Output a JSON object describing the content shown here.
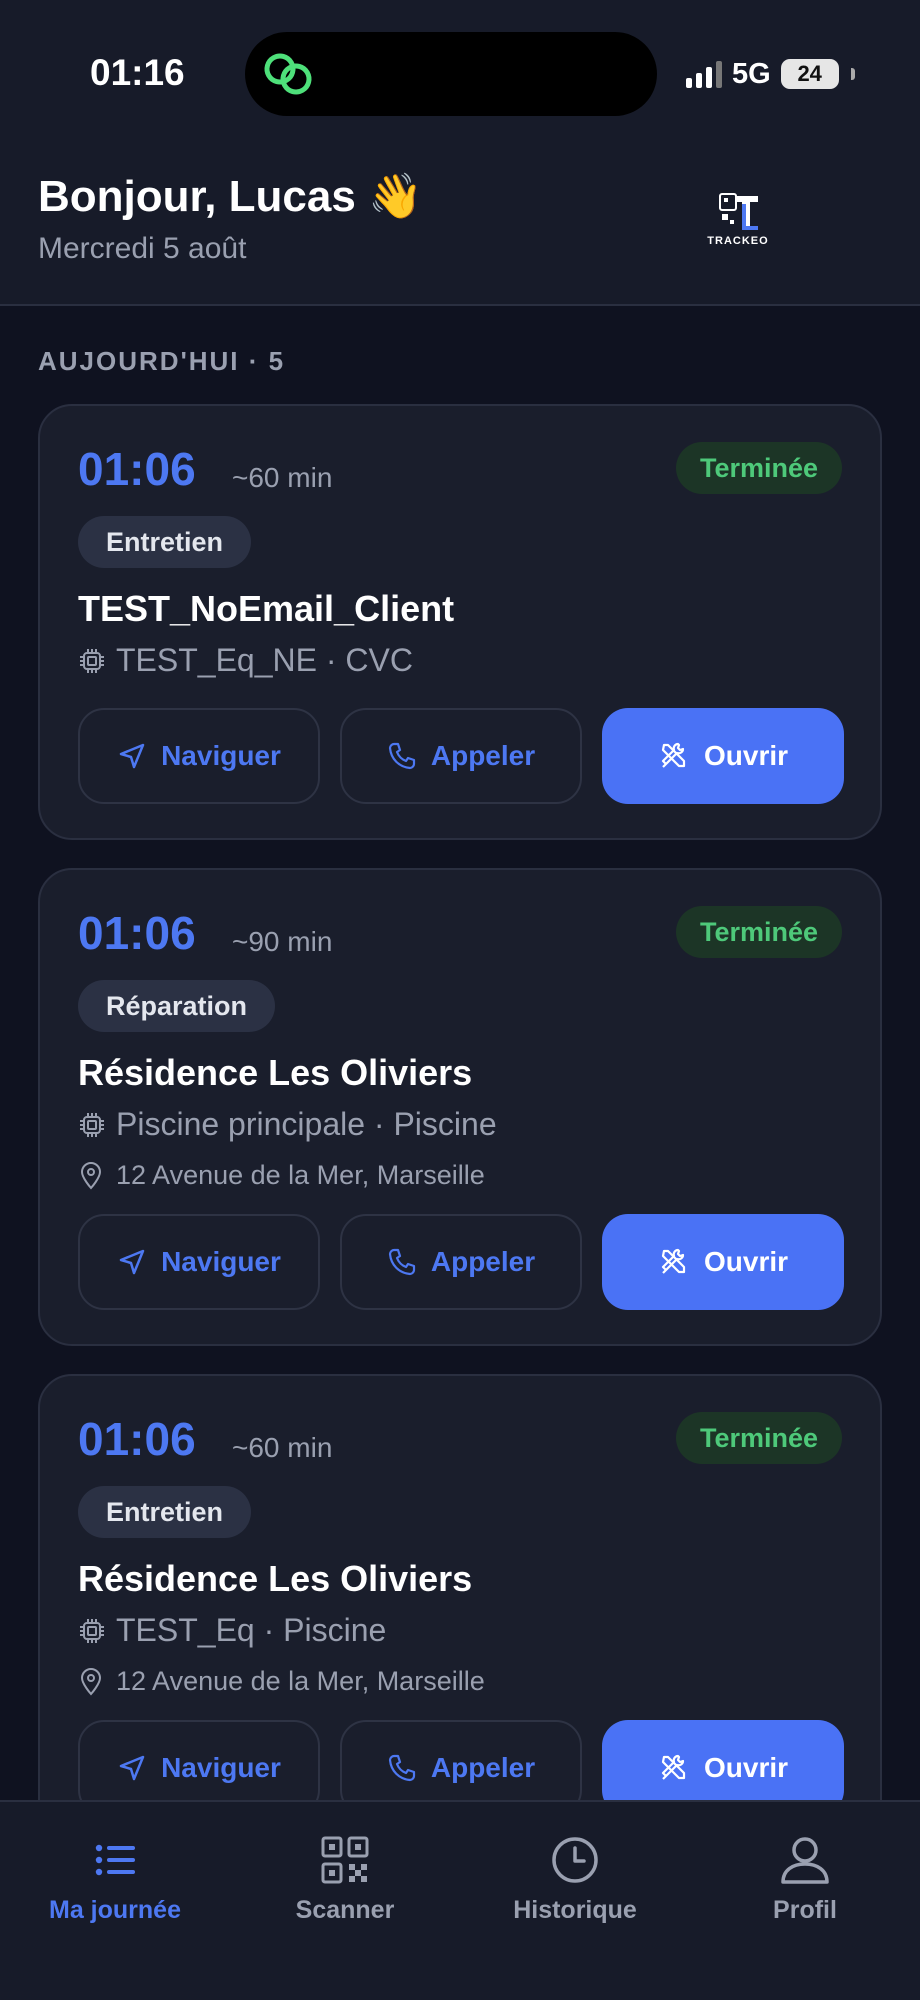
{
  "status_bar": {
    "time": "01:16",
    "network": "5G",
    "battery": "24"
  },
  "header": {
    "greeting": "Bonjour, Lucas 👋",
    "date": "Mercredi 5 août",
    "logo_text": "TRACKEO"
  },
  "section": {
    "title": "AUJOURD'HUI · 5"
  },
  "cards": [
    {
      "time": "01:06",
      "duration": "~60 min",
      "status": "Terminée",
      "type": "Entretien",
      "client": "TEST_NoEmail_Client",
      "equipment": "TEST_Eq_NE · CVC",
      "address": "",
      "actions": {
        "navigate": "Naviguer",
        "call": "Appeler",
        "open": "Ouvrir"
      }
    },
    {
      "time": "01:06",
      "duration": "~90 min",
      "status": "Terminée",
      "type": "Réparation",
      "client": "Résidence Les Oliviers",
      "equipment": "Piscine principale · Piscine",
      "address": "12 Avenue de la Mer, Marseille",
      "actions": {
        "navigate": "Naviguer",
        "call": "Appeler",
        "open": "Ouvrir"
      }
    },
    {
      "time": "01:06",
      "duration": "~60 min",
      "status": "Terminée",
      "type": "Entretien",
      "client": "Résidence Les Oliviers",
      "equipment": "TEST_Eq · Piscine",
      "address": "12 Avenue de la Mer, Marseille",
      "actions": {
        "navigate": "Naviguer",
        "call": "Appeler",
        "open": "Ouvrir"
      }
    }
  ],
  "bottom_nav": [
    {
      "label": "Ma journée",
      "icon": "list-icon",
      "active": true
    },
    {
      "label": "Scanner",
      "icon": "qr-code-icon",
      "active": false
    },
    {
      "label": "Historique",
      "icon": "clock-icon",
      "active": false
    },
    {
      "label": "Profil",
      "icon": "user-icon",
      "active": false
    }
  ],
  "colors": {
    "accent": "#4d78f2",
    "primary_button": "#4a72f5",
    "status_done_bg": "#1c3526",
    "status_done_text": "#4ec97a",
    "background": "#0f1220",
    "card": "#1a1e2c"
  }
}
